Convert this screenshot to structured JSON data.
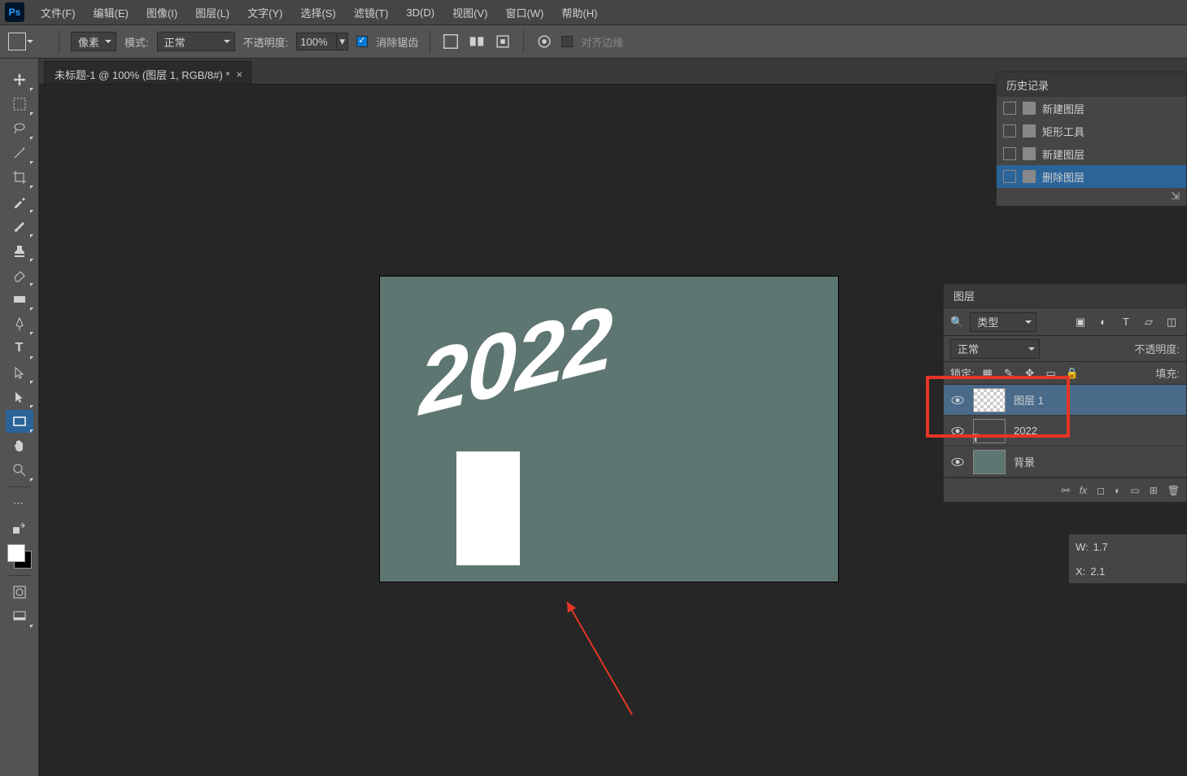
{
  "menubar": {
    "items": [
      "文件(F)",
      "编辑(E)",
      "图像(I)",
      "图层(L)",
      "文字(Y)",
      "选择(S)",
      "滤镜(T)",
      "3D(D)",
      "视图(V)",
      "窗口(W)",
      "帮助(H)"
    ]
  },
  "options": {
    "unit": "像素",
    "mode_label": "模式:",
    "mode_value": "正常",
    "opacity_label": "不透明度:",
    "opacity_value": "100%",
    "antialias": "消除锯齿",
    "align_edges": "对齐边缘"
  },
  "tab": {
    "title": "未标题-1 @ 100% (图层 1, RGB/8#) *"
  },
  "canvas": {
    "year": "2022"
  },
  "history": {
    "title": "历史记录",
    "items": [
      "新建图层",
      "矩形工具",
      "新建图层",
      "删除图层"
    ]
  },
  "layers": {
    "title": "图层",
    "filter": "类型",
    "blend": "正常",
    "opacity_label": "不透明度:",
    "fill_label": "填充:",
    "lock_label": "锁定:",
    "items": [
      {
        "name": "图层 1"
      },
      {
        "name": "2022"
      },
      {
        "name": "背景"
      }
    ]
  },
  "props": {
    "w_label": "W:",
    "w_value": "1.7",
    "x_label": "X:",
    "x_value": "2.1"
  }
}
